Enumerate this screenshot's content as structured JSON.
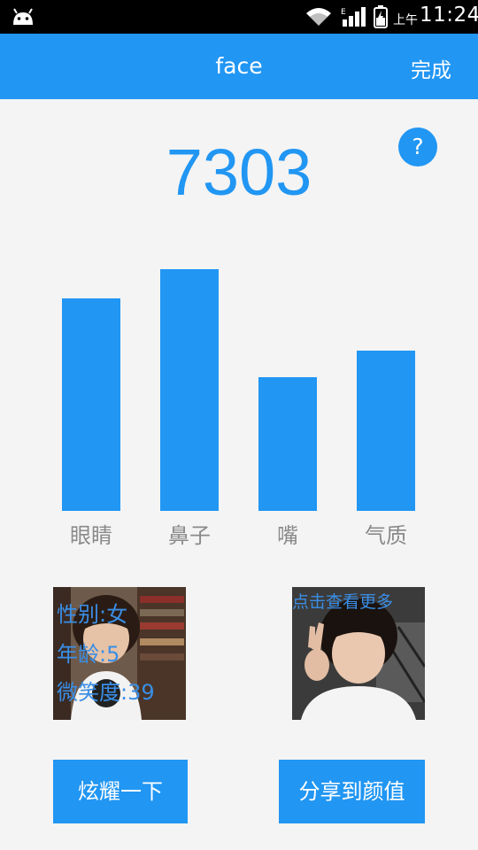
{
  "status_bar": {
    "ampm": "上午",
    "time": "11:24",
    "icons": [
      "android-icon",
      "wifi-icon",
      "signal-icon",
      "battery-icon"
    ]
  },
  "app_bar": {
    "title": "face",
    "done_label": "完成"
  },
  "help_label": "?",
  "score": "7303",
  "chart_data": {
    "type": "bar",
    "categories": [
      "眼睛",
      "鼻子",
      "嘴",
      "气质"
    ],
    "values": [
      240,
      273,
      151,
      181
    ],
    "bar_color": "#2196f3",
    "label_color": "#8a8a8a",
    "grid": false,
    "title": "",
    "xlabel": "",
    "ylabel": ""
  },
  "profile": {
    "gender": "性别:女",
    "age": "年龄:5",
    "smile": "微笑度:39"
  },
  "more_link": "点击查看更多",
  "buttons": {
    "show_off": "炫耀一下",
    "share": "分享到颜值"
  },
  "colors": {
    "accent": "#2196f3",
    "background": "#f4f4f4"
  }
}
